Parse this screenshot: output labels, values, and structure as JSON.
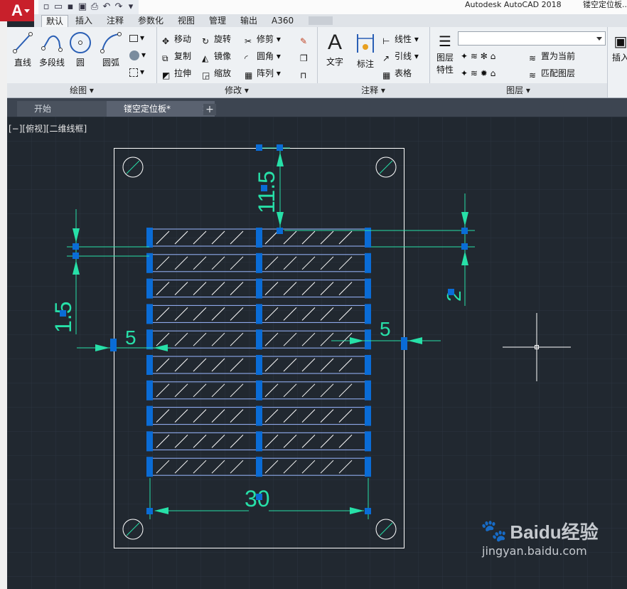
{
  "app": {
    "title": "Autodesk AutoCAD 2018",
    "document_title": "镂空定位板...",
    "logo_letter": "A"
  },
  "ribbon_tabs": [
    "默认",
    "插入",
    "注释",
    "参数化",
    "视图",
    "管理",
    "输出",
    "A360"
  ],
  "panels": {
    "draw": {
      "title": "绘图",
      "tools": [
        "直线",
        "多段线",
        "圆",
        "圆弧"
      ]
    },
    "modify": {
      "title": "修改",
      "tools": [
        "移动",
        "旋转",
        "修剪",
        "复制",
        "镜像",
        "圆角",
        "拉伸",
        "缩放",
        "阵列"
      ]
    },
    "annotation": {
      "title": "注释",
      "tools": [
        "文字",
        "标注",
        "线性",
        "引线",
        "表格"
      ]
    },
    "layers": {
      "title": "图层",
      "properties_label_1": "图层",
      "properties_label_2": "特性",
      "tools": [
        "置为当前",
        "匹配图层"
      ]
    },
    "insert": {
      "label": "插入"
    }
  },
  "file_tabs": [
    "开始",
    "镂空定位板*"
  ],
  "viewport_label": "[−][俯视][二维线框]",
  "dimensions": [
    "11.5",
    "1.5",
    "2",
    "5",
    "5",
    "30"
  ],
  "watermark": {
    "brand": "Baidu经验",
    "url": "jingyan.baidu.com"
  },
  "colors": {
    "background": "#212830",
    "outline": "#ffffff",
    "dimension": "#27e0a8",
    "grip": "#0a6cd6",
    "hatch": "#ffffff"
  }
}
